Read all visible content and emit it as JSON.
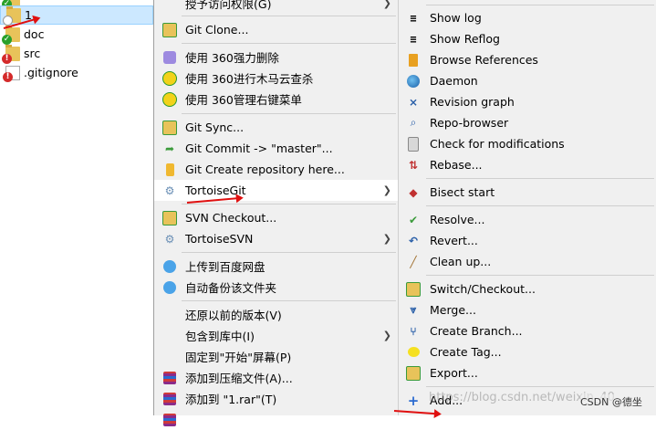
{
  "files": [
    {
      "name": "1",
      "overlay": "white",
      "selected": true
    },
    {
      "name": "doc",
      "overlay": "green"
    },
    {
      "name": "src",
      "overlay": "red"
    },
    {
      "name": ".gitignore",
      "overlay": "red"
    }
  ],
  "menu1": {
    "grant_access": "授予访问权限(G)",
    "git_clone": "Git Clone...",
    "m360_delete": "使用 360强力删除",
    "m360_scan": "使用 360进行木马云查杀",
    "m360_menu": "使用 360管理右键菜单",
    "git_sync": "Git Sync...",
    "git_commit": "Git Commit -> \"master\"...",
    "git_create_repo": "Git Create repository here...",
    "tortoisegit": "TortoiseGit",
    "svn_checkout": "SVN Checkout...",
    "tortoisesvn": "TortoiseSVN",
    "upload_baidu": "上传到百度网盘",
    "auto_backup": "自动备份该文件夹",
    "restore": "还原以前的版本(V)",
    "include_lib": "包含到库中(I)",
    "pin_start": "固定到\"开始\"屏幕(P)",
    "add_archive": "添加到压缩文件(A)...",
    "add_rar": "添加到 \"1.rar\"(T)"
  },
  "menu2": {
    "show_log": "Show log",
    "show_reflog": "Show Reflog",
    "browse_refs": "Browse References",
    "daemon": "Daemon",
    "revision_graph": "Revision graph",
    "repo_browser": "Repo-browser",
    "check_mods": "Check for modifications",
    "rebase": "Rebase...",
    "bisect_start": "Bisect start",
    "resolve": "Resolve...",
    "revert": "Revert...",
    "clean_up": "Clean up...",
    "switch_checkout": "Switch/Checkout...",
    "merge": "Merge...",
    "create_branch": "Create Branch...",
    "create_tag": "Create Tag...",
    "export": "Export...",
    "add": "Add..."
  },
  "watermark": "https://blog.csdn.net/weixin_40...",
  "csdn_badge": "CSDN @德坐"
}
